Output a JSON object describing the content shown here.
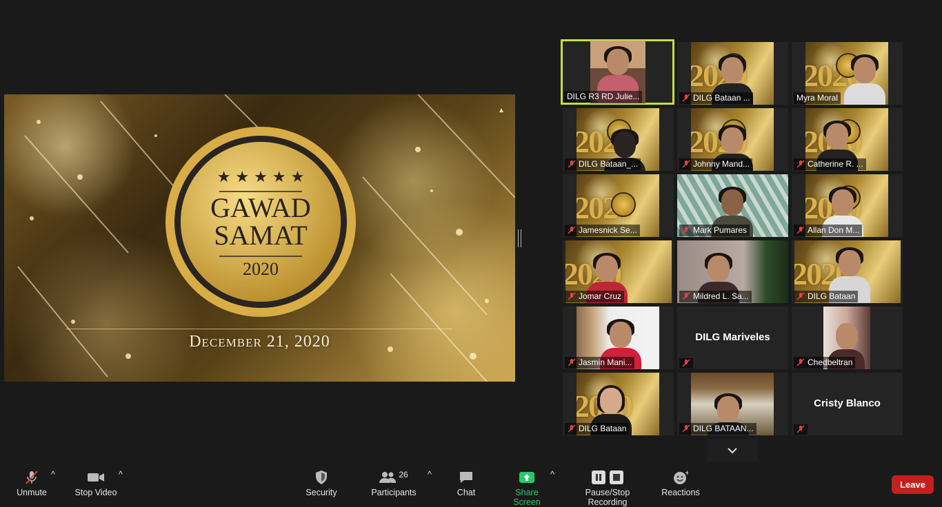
{
  "share": {
    "badge_title_line1": "GAWAD",
    "badge_title_line2": "SAMAT",
    "badge_year": "2020",
    "date": "December 21, 2020"
  },
  "gallery": {
    "tiles": [
      {
        "name": "DILG R3 RD Julie...",
        "muted": false,
        "video": true
      },
      {
        "name": "DILG Bataan ...",
        "muted": true,
        "video": true
      },
      {
        "name": "Myra Moral",
        "muted": false,
        "video": true
      },
      {
        "name": "DILG Bataan_...",
        "muted": true,
        "video": true
      },
      {
        "name": "Johnny Mand...",
        "muted": true,
        "video": true
      },
      {
        "name": "Catherine R. ...",
        "muted": true,
        "video": true
      },
      {
        "name": "Jamesnick Se...",
        "muted": true,
        "video": true
      },
      {
        "name": "Mark Pumares",
        "muted": true,
        "video": true
      },
      {
        "name": "Allan Don M...",
        "muted": true,
        "video": true
      },
      {
        "name": "Jomar Cruz",
        "muted": true,
        "video": true
      },
      {
        "name": "Mildred L. Sa...",
        "muted": true,
        "video": true
      },
      {
        "name": "DILG Bataan",
        "muted": true,
        "video": true
      },
      {
        "name": "Jasmin Mani...",
        "muted": true,
        "video": true
      },
      {
        "name": "DILG Mariveles",
        "muted": true,
        "video": false
      },
      {
        "name": "Chedbeltran",
        "muted": true,
        "video": true
      },
      {
        "name": "DILG Bataan",
        "muted": true,
        "video": true
      },
      {
        "name": "DILG BATAAN...",
        "muted": true,
        "video": true
      },
      {
        "name": "Cristy Blanco",
        "muted": true,
        "video": false
      }
    ]
  },
  "toolbar": {
    "unmute": "Unmute",
    "stop_video": "Stop Video",
    "security": "Security",
    "participants": "Participants",
    "participants_count": "26",
    "chat": "Chat",
    "share_screen": "Share Screen",
    "recording": "Pause/Stop Recording",
    "reactions": "Reactions",
    "leave": "Leave"
  },
  "colors": {
    "accent_green": "#2ac769",
    "active_speaker": "#c4e03d",
    "leave_red": "#c3201f",
    "muted_red": "#e0443e"
  }
}
